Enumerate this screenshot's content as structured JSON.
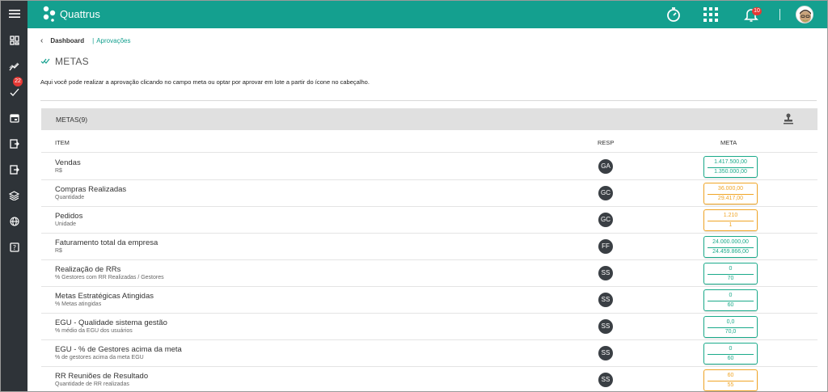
{
  "app": {
    "name": "Quattrus",
    "notification_count": "10",
    "colors": {
      "brand": "#14a08f",
      "sidebar": "#2e3338",
      "green": "#1aaa8a",
      "orange": "#f0a526",
      "badge": "#e53935"
    }
  },
  "sidebar": {
    "items": [
      {
        "icon": "menu-icon"
      },
      {
        "icon": "dashboard-icon"
      },
      {
        "icon": "trend-icon"
      },
      {
        "icon": "approvals-icon",
        "badge": "22"
      },
      {
        "icon": "calendar-icon"
      },
      {
        "icon": "export-icon"
      },
      {
        "icon": "logout-icon"
      },
      {
        "icon": "layers-icon"
      },
      {
        "icon": "globe-icon"
      },
      {
        "icon": "help-icon"
      }
    ]
  },
  "breadcrumb": {
    "parent": "Dashboard",
    "separator": "|",
    "current": "Aprovações"
  },
  "page": {
    "title": "METAS",
    "intro": "Aqui você pode realizar a aprovação clicando no campo meta ou optar por aprovar em lote a partir do ícone no cabeçalho."
  },
  "table": {
    "title": "METAS(9)",
    "columns": {
      "item": "ITEM",
      "resp": "RESP",
      "meta": "META"
    },
    "rows": [
      {
        "name": "Vendas",
        "unit": "R$",
        "resp": "GA",
        "meta_top": "1.417.500,00",
        "meta_bottom": "1.350.000,00",
        "status": "green"
      },
      {
        "name": "Compras Realizadas",
        "unit": "Quantidade",
        "resp": "GC",
        "meta_top": "36.000,00",
        "meta_bottom": "29.417,00",
        "status": "orange"
      },
      {
        "name": "Pedidos",
        "unit": "Unidade",
        "resp": "GC",
        "meta_top": "1.210",
        "meta_bottom": "1",
        "status": "orange"
      },
      {
        "name": "Faturamento total da empresa",
        "unit": "R$",
        "resp": "FF",
        "meta_top": "24.000.000,00",
        "meta_bottom": "24.459.866,00",
        "status": "green"
      },
      {
        "name": "Realização de RRs",
        "unit": "% Gestores com RR Realizadas / Gestores",
        "resp": "SS",
        "meta_top": "0",
        "meta_bottom": "70",
        "status": "green"
      },
      {
        "name": "Metas Estratégicas Atingidas",
        "unit": "% Metas atingidas",
        "resp": "SS",
        "meta_top": "0",
        "meta_bottom": "60",
        "status": "green"
      },
      {
        "name": "EGU - Qualidade sistema gestão",
        "unit": "% médio da EGU dos usuários",
        "resp": "SS",
        "meta_top": "0,0",
        "meta_bottom": "70,0",
        "status": "green"
      },
      {
        "name": "EGU - % de Gestores acima da meta",
        "unit": "% de gestores acima da meta EGU",
        "resp": "SS",
        "meta_top": "0",
        "meta_bottom": "60",
        "status": "green"
      },
      {
        "name": "RR Reuniões de Resultado",
        "unit": "Quantidade de RR realizadas",
        "resp": "SS",
        "meta_top": "60",
        "meta_bottom": "55",
        "status": "orange"
      }
    ]
  }
}
